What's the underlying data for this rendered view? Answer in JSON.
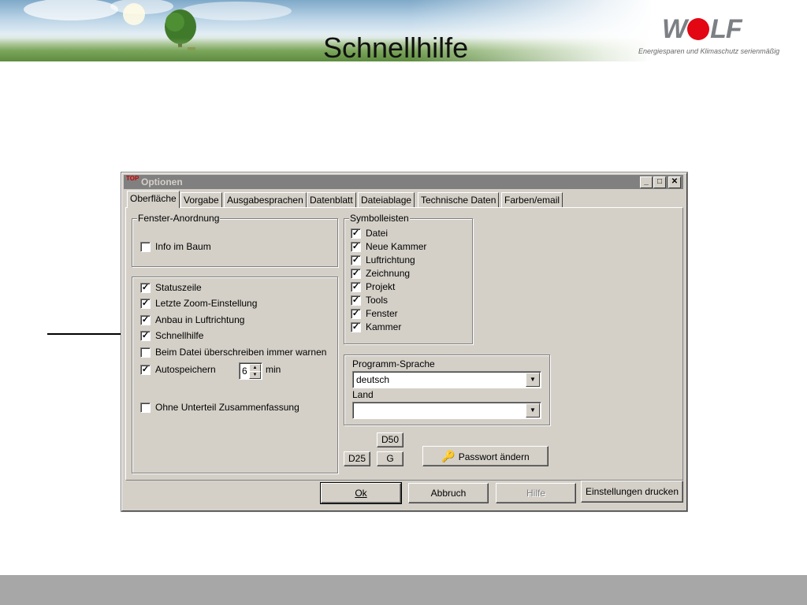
{
  "slide": {
    "title": "Schnellhilfe",
    "logo_text": "WOLF",
    "tagline": "Energiesparen und Klimaschutz serienmäßig"
  },
  "dialog": {
    "icon_text": "TOP",
    "title": "Optionen",
    "titlebar_buttons": [
      "_",
      "□",
      "✕"
    ],
    "tabs": [
      "Oberfläche",
      "Vorgabe",
      "Ausgabesprachen",
      "Datenblatt",
      "Dateiablage",
      "Technische Daten",
      "Farben/email"
    ],
    "active_tab": "Oberfläche",
    "fenster_group": {
      "label": "Fenster-Anordnung",
      "items": [
        {
          "label": "Info im Baum",
          "checked": false
        }
      ]
    },
    "options_group": {
      "items": [
        {
          "label": "Statuszeile",
          "checked": true
        },
        {
          "label": "Letzte Zoom-Einstellung",
          "checked": true
        },
        {
          "label": "Anbau in Luftrichtung",
          "checked": true
        },
        {
          "label": "Schnellhilfe",
          "checked": true
        },
        {
          "label": "Beim Datei überschreiben immer warnen",
          "checked": false
        },
        {
          "label": "Autospeichern",
          "checked": true
        },
        {
          "label": "Ohne Unterteil Zusammenfassung",
          "checked": false
        }
      ],
      "autosave_value": "6",
      "autosave_unit": "min"
    },
    "symbolleisten_group": {
      "label": "Symbolleisten",
      "items": [
        {
          "label": "Datei",
          "checked": true
        },
        {
          "label": "Neue Kammer",
          "checked": true
        },
        {
          "label": "Luftrichtung",
          "checked": true
        },
        {
          "label": "Zeichnung",
          "checked": true
        },
        {
          "label": "Projekt",
          "checked": true
        },
        {
          "label": "Tools",
          "checked": true
        },
        {
          "label": "Fenster",
          "checked": true
        },
        {
          "label": "Kammer",
          "checked": true
        }
      ]
    },
    "language_group": {
      "language_label": "Programm-Sprache",
      "language_value": "deutsch",
      "country_label": "Land",
      "country_value": ""
    },
    "small_buttons": {
      "d50": "D50",
      "d25": "D25",
      "g": "G"
    },
    "password_button": "Passwort ändern",
    "bottom_buttons": {
      "ok": "Ok",
      "cancel": "Abbruch",
      "help": "Hilfe",
      "print": "Einstellungen drucken"
    }
  },
  "colors": {
    "wolf_red": "#e30613",
    "footer_gray": "#a7a7a7",
    "dialog_face": "#d4d0c8"
  }
}
